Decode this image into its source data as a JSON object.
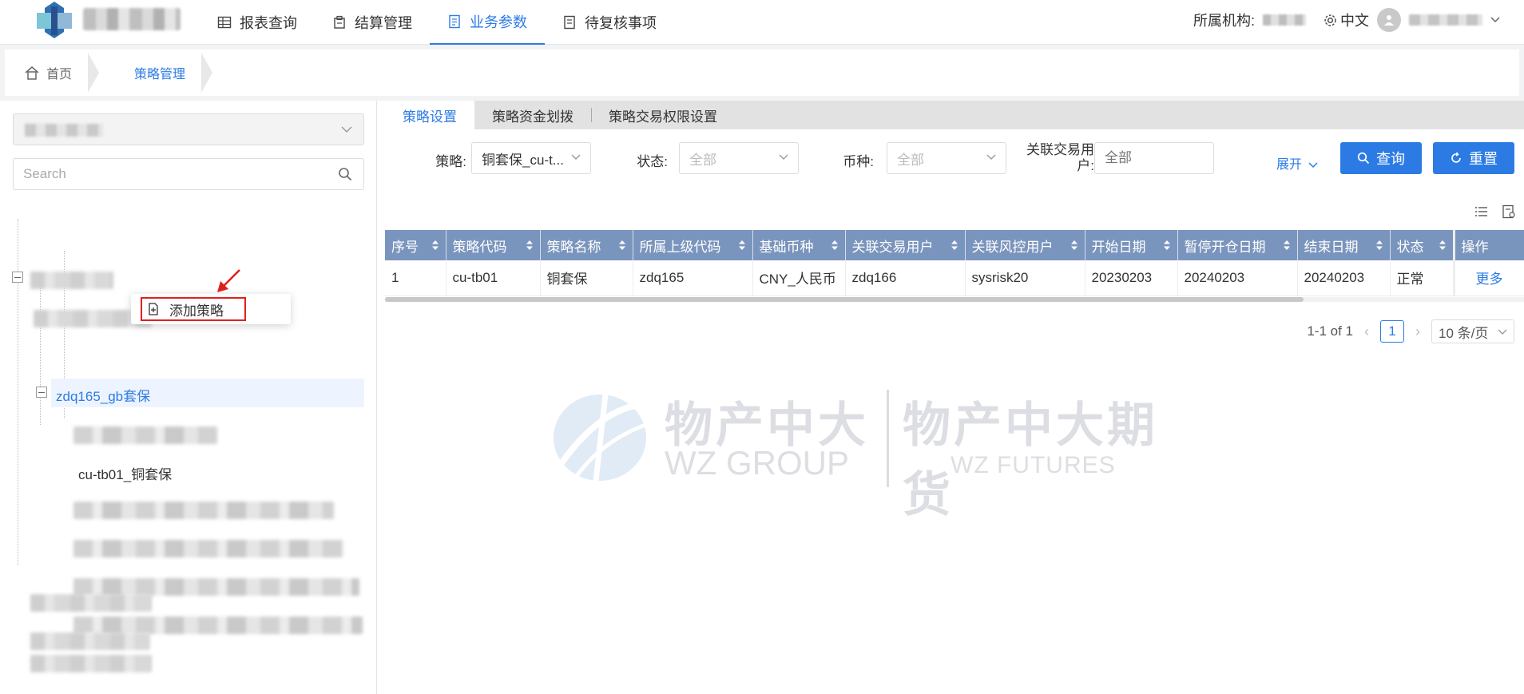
{
  "nav": {
    "items": [
      {
        "label": "报表查询",
        "icon": "table-icon"
      },
      {
        "label": "结算管理",
        "icon": "calculator-icon"
      },
      {
        "label": "业务参数",
        "icon": "document-icon",
        "active": true
      },
      {
        "label": "待复核事项",
        "icon": "checklist-icon"
      }
    ],
    "org_label": "所属机构:",
    "language": "中文"
  },
  "breadcrumb": {
    "home": "首页",
    "current": "策略管理"
  },
  "left": {
    "search_placeholder": "Search",
    "tree": {
      "selected_node": "zdq165_gb套保",
      "child_node": "cu-tb01_铜套保"
    },
    "context_menu": {
      "add_label": "添加策略"
    }
  },
  "tabs": [
    {
      "label": "策略设置",
      "active": true
    },
    {
      "label": "策略资金划拨"
    },
    {
      "label": "策略交易权限设置"
    }
  ],
  "filters": {
    "strategy_label": "策略:",
    "strategy_value": "铜套保_cu-t...",
    "status_label": "状态:",
    "status_value": "全部",
    "currency_label": "币种:",
    "currency_value": "全部",
    "user_label": "关联交易用户:",
    "user_placeholder": "全部",
    "expand_label": "展开",
    "query_label": "查询",
    "reset_label": "重置"
  },
  "table": {
    "columns": [
      "序号",
      "策略代码",
      "策略名称",
      "所属上级代码",
      "基础币种",
      "关联交易用户",
      "关联风控用户",
      "开始日期",
      "暂停开仓日期",
      "结束日期",
      "状态"
    ],
    "op_column": "操作",
    "rows": [
      {
        "cells": [
          "1",
          "cu-tb01",
          "铜套保",
          "zdq165",
          "CNY_人民币",
          "zdq166",
          "sysrisk20",
          "20230203",
          "20240203",
          "20240203",
          "正常"
        ],
        "op": "更多"
      }
    ]
  },
  "pager": {
    "summary": "1-1 of 1",
    "page": "1",
    "page_size": "10 条/页"
  },
  "watermark": {
    "cn_group": "物产中大",
    "en_group": "WZ GROUP",
    "cn_futures": "物产中大期货",
    "en_futures": "WZ FUTURES"
  },
  "colors": {
    "accent": "#2c7be5",
    "header_bg": "#7a95bd",
    "highlight_red": "#e0201e"
  }
}
